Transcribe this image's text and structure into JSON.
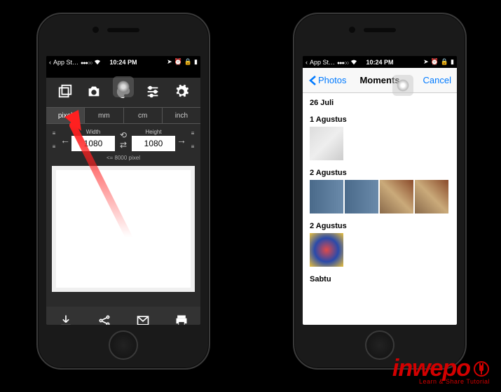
{
  "status": {
    "back_app": "App St…",
    "time": "10:24 PM"
  },
  "editor": {
    "units": [
      "pixel",
      "mm",
      "cm",
      "inch"
    ],
    "active_unit": "pixel",
    "width_label": "Width",
    "height_label": "Height",
    "width_value": "1080",
    "height_value": "1080",
    "hint": "<= 8000 pixel"
  },
  "photos": {
    "back_label": "Photos",
    "title": "Moments",
    "cancel_label": "Cancel",
    "sections": [
      {
        "header": "26 Juli"
      },
      {
        "header": "1 Agustus"
      },
      {
        "header": "2 Agustus"
      },
      {
        "header": "2 Agustus"
      },
      {
        "header": "Sabtu"
      }
    ]
  },
  "brand": {
    "name": "inwepo",
    "tagline": "Learn & Share Tutorial"
  }
}
